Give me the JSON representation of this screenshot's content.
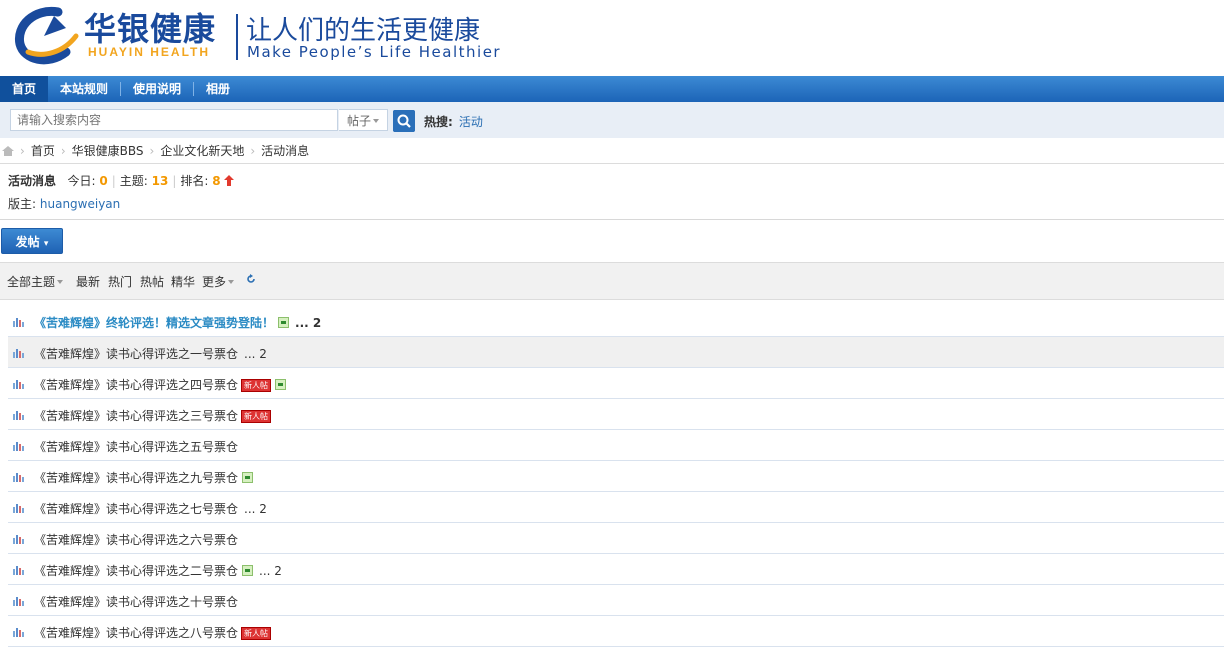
{
  "brand": {
    "name_cn": "华银健康",
    "name_en": "HUAYIN HEALTH",
    "slogan_cn": "让人们的生活更健康",
    "slogan_en": "Make People’s Life  Healthier"
  },
  "nav": {
    "items": [
      {
        "label": "首页",
        "active": true
      },
      {
        "label": "本站规则",
        "active": false
      },
      {
        "label": "使用说明",
        "active": false
      },
      {
        "label": "相册",
        "active": false
      }
    ]
  },
  "search": {
    "placeholder": "请输入搜索内容",
    "type_label": "帖子",
    "hot_label": "热搜:",
    "hot_terms": [
      "活动"
    ]
  },
  "breadcrumb": [
    "首页",
    "华银健康BBS",
    "企业文化新天地",
    "活动消息"
  ],
  "forum": {
    "name": "活动消息",
    "today_label": "今日:",
    "today_value": "0",
    "topics_label": "主题:",
    "topics_value": "13",
    "rank_label": "排名:",
    "rank_value": "8",
    "moderator_label": "版主:",
    "moderator_name": "huangweiyan"
  },
  "post_button": {
    "label": "发帖"
  },
  "filters": {
    "all": "全部主题",
    "latest": "最新",
    "hot": "热门",
    "hot_posts": "热帖",
    "digest": "精华",
    "more": "更多"
  },
  "threads": [
    {
      "title": "《苦难辉煌》终轮评选！精选文章强势登陆！",
      "top": true,
      "image": true,
      "new": false,
      "pages": "... 2"
    },
    {
      "title": "《苦难辉煌》读书心得评选之一号票仓",
      "top": false,
      "image": false,
      "new": false,
      "pages": "... 2",
      "highlight": true
    },
    {
      "title": "《苦难辉煌》读书心得评选之四号票仓",
      "top": false,
      "image": true,
      "new": true,
      "pages": ""
    },
    {
      "title": "《苦难辉煌》读书心得评选之三号票仓",
      "top": false,
      "image": false,
      "new": true,
      "pages": ""
    },
    {
      "title": "《苦难辉煌》读书心得评选之五号票仓",
      "top": false,
      "image": false,
      "new": false,
      "pages": ""
    },
    {
      "title": "《苦难辉煌》读书心得评选之九号票仓",
      "top": false,
      "image": true,
      "new": false,
      "pages": ""
    },
    {
      "title": "《苦难辉煌》读书心得评选之七号票仓",
      "top": false,
      "image": false,
      "new": false,
      "pages": "... 2"
    },
    {
      "title": "《苦难辉煌》读书心得评选之六号票仓",
      "top": false,
      "image": false,
      "new": false,
      "pages": ""
    },
    {
      "title": "《苦难辉煌》读书心得评选之二号票仓",
      "top": false,
      "image": true,
      "new": false,
      "pages": "... 2"
    },
    {
      "title": "《苦难辉煌》读书心得评选之十号票仓",
      "top": false,
      "image": false,
      "new": false,
      "pages": ""
    },
    {
      "title": "《苦难辉煌》读书心得评选之八号票仓",
      "top": false,
      "image": false,
      "new": true,
      "pages": ""
    }
  ],
  "new_badge_label": "新人帖",
  "colors": {
    "nav_blue": "#1c64b7",
    "brand_blue": "#1a4a9c",
    "brand_gold": "#f2a51f",
    "count_orange": "#f39800",
    "link_blue": "#2b6fb3"
  }
}
